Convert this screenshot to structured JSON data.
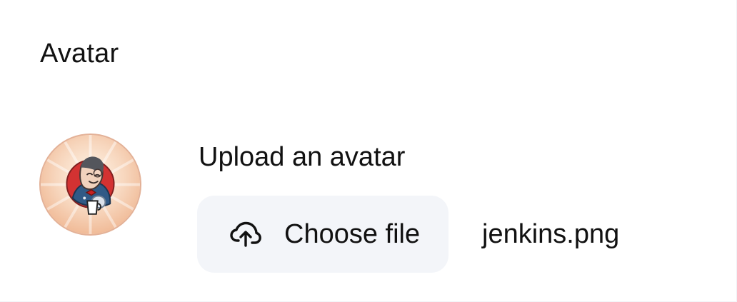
{
  "section": {
    "title": "Avatar"
  },
  "avatar": {
    "icon": "jenkins-avatar-icon",
    "colors": {
      "outer_ring": "#e3b197",
      "sunburst_light": "#fff0df",
      "sunburst_mid": "#f3c6a6",
      "character_red": "#d33232",
      "character_blue": "#315a86",
      "mug_white": "#ffffff"
    }
  },
  "upload": {
    "label": "Upload an avatar",
    "button_label": "Choose file",
    "button_icon": "cloud-upload-icon",
    "selected_file": "jenkins.png",
    "button_color": "#f3f5f9"
  }
}
